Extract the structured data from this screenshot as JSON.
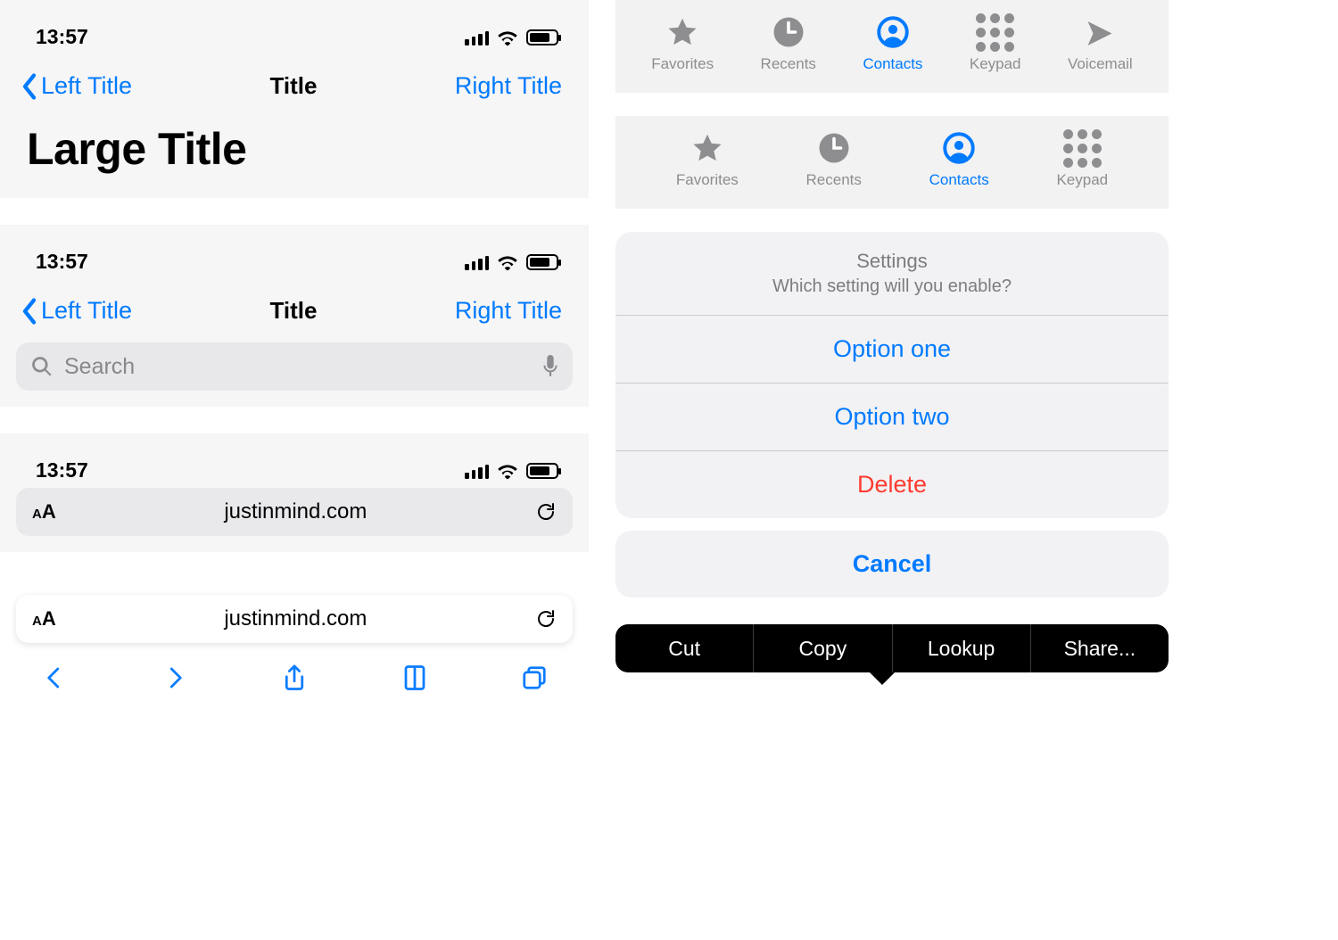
{
  "status": {
    "time": "13:57"
  },
  "nav": {
    "left_title": "Left Title",
    "center_title": "Title",
    "right_title": "Right Title",
    "large_title": "Large Title"
  },
  "search": {
    "placeholder": "Search"
  },
  "url": {
    "domain": "justinmind.com"
  },
  "tabs5": {
    "items": [
      {
        "label": "Favorites",
        "icon": "star-icon"
      },
      {
        "label": "Recents",
        "icon": "clock-icon"
      },
      {
        "label": "Contacts",
        "icon": "contacts-icon",
        "active": true
      },
      {
        "label": "Keypad",
        "icon": "keypad-icon"
      },
      {
        "label": "Voicemail",
        "icon": "voicemail-icon"
      }
    ]
  },
  "tabs4": {
    "items": [
      {
        "label": "Favorites",
        "icon": "star-icon"
      },
      {
        "label": "Recents",
        "icon": "clock-icon"
      },
      {
        "label": "Contacts",
        "icon": "contacts-icon",
        "active": true
      },
      {
        "label": "Keypad",
        "icon": "keypad-icon"
      }
    ]
  },
  "actionsheet": {
    "title": "Settings",
    "message": "Which setting will you enable?",
    "options": [
      {
        "label": "Option one"
      },
      {
        "label": "Option two"
      },
      {
        "label": "Delete",
        "destructive": true
      }
    ],
    "cancel": "Cancel"
  },
  "editmenu": {
    "items": [
      "Cut",
      "Copy",
      "Lookup",
      "Share..."
    ]
  },
  "colors": {
    "blue": "#007aff",
    "red": "#ff3b30",
    "gray": "#8e8e90"
  }
}
